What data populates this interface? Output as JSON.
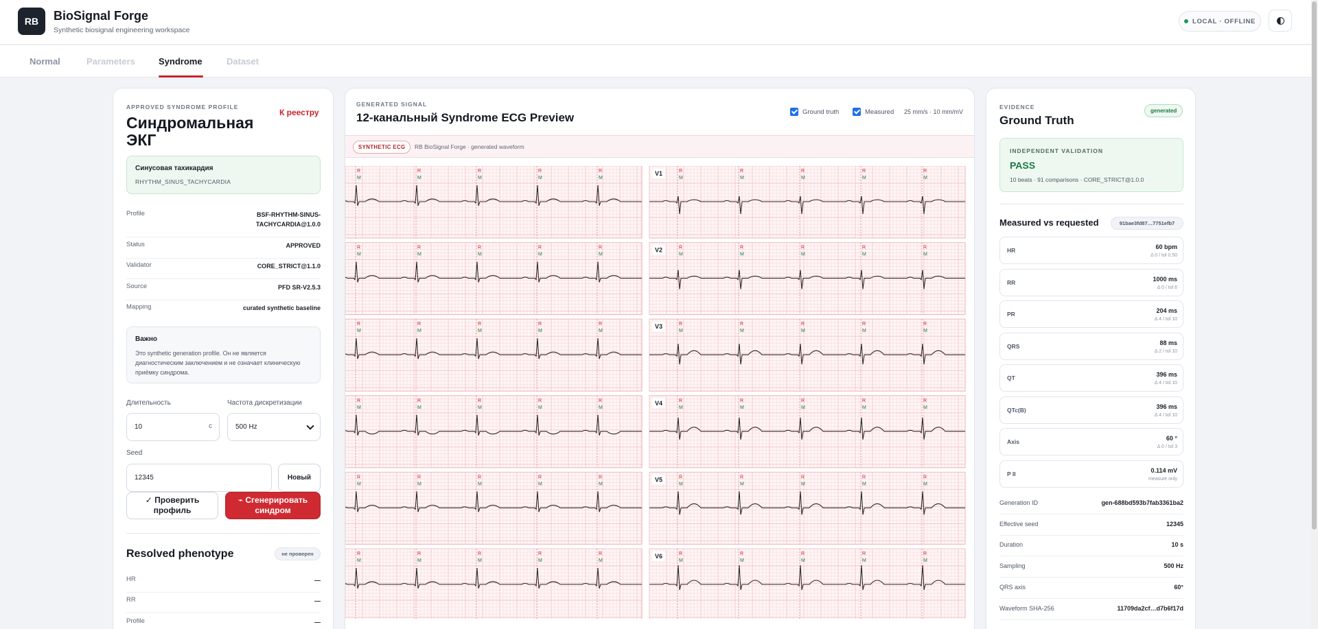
{
  "app": {
    "logo": "RB",
    "title": "BioSignal Forge",
    "subtitle": "Synthetic biosignal engineering workspace",
    "status": "LOCAL · OFFLINE",
    "theme_icon": "contrast-icon"
  },
  "tabs": [
    {
      "label": "Normal",
      "state": "inactive"
    },
    {
      "label": "Parameters",
      "state": "disabled"
    },
    {
      "label": "Syndrome",
      "state": "active"
    },
    {
      "label": "Dataset",
      "state": "disabled"
    }
  ],
  "left": {
    "eyebrow": "APPROVED SYNDROME PROFILE",
    "registry_link": "К реестру",
    "title": "Синдромальная ЭКГ",
    "rhythm_name": "Синусовая тахикардия",
    "rhythm_code": "RHYTHM_SINUS_TACHYCARDIA",
    "details": [
      {
        "k": "Profile",
        "v": "BSF-RHYTHM-SINUS-TACHYCARDIA@1.0.0"
      },
      {
        "k": "Status",
        "v": "APPROVED"
      },
      {
        "k": "Validator",
        "v": "CORE_STRICT@1.1.0"
      },
      {
        "k": "Source",
        "v": "PFD SR-V2.5.3"
      },
      {
        "k": "Mapping",
        "v": "curated synthetic baseline"
      }
    ],
    "note_title": "Важно",
    "note_text": "Это synthetic generation profile. Он не является диагностическим заключением и не означает клиническую приёмку синдрома.",
    "duration_label": "Длительность",
    "duration_value": "10",
    "duration_unit": "c",
    "sampling_label": "Частота дискретизации",
    "sampling_value": "500 Hz",
    "seed_label": "Seed",
    "seed_value": "12345",
    "new_button": "Новый",
    "check_button": "✓ Проверить профиль",
    "generate_button": "⌁ Сгенерировать синдром",
    "phenotype_title": "Resolved phenotype",
    "phenotype_badge": "не проверен",
    "phenotype_rows": [
      {
        "k": "HR",
        "v": "—"
      },
      {
        "k": "RR",
        "v": "—"
      },
      {
        "k": "Profile",
        "v": "—"
      }
    ]
  },
  "center": {
    "eyebrow": "GENERATED SIGNAL",
    "title": "12-канальный Syndrome ECG Preview",
    "ground_truth_label": "Ground truth",
    "ground_truth_checked": true,
    "measured_label": "Measured",
    "measured_checked": true,
    "scale": "25 mm/s · 10 mm/mV",
    "tag": "SYNTHETIC ECG",
    "strip_text": "RB BioSignal Forge · generated waveform",
    "leads_right": [
      "V1",
      "V2",
      "V3",
      "V4",
      "V5",
      "V6"
    ],
    "marker_top": "R",
    "marker_bottom": "M",
    "grid_color": "#f3c4c8",
    "trace_color": "#2b2b2b"
  },
  "right": {
    "eyebrow": "EVIDENCE",
    "badge": "generated",
    "title": "Ground Truth",
    "validation_eyebrow": "INDEPENDENT VALIDATION",
    "validation_result": "PASS",
    "validation_sub": "10 beats · 91 comparisons · CORE_STRICT@1.0.0",
    "mvr_title": "Measured vs requested",
    "hash": "91bae3fd87…7751efb7",
    "metrics": [
      {
        "k": "HR",
        "v": "60 bpm",
        "t": "Δ 0 / tol 0.50"
      },
      {
        "k": "RR",
        "v": "1000 ms",
        "t": "Δ 0 / tol 6"
      },
      {
        "k": "PR",
        "v": "204 ms",
        "t": "Δ 4 / tol 10"
      },
      {
        "k": "QRS",
        "v": "88 ms",
        "t": "Δ 2 / tol 10"
      },
      {
        "k": "QT",
        "v": "396 ms",
        "t": "Δ 4 / tol 10"
      },
      {
        "k": "QTc(B)",
        "v": "396 ms",
        "t": "Δ 4 / tol 10"
      },
      {
        "k": "Axis",
        "v": "60 °",
        "t": "Δ 0 / tol 3"
      },
      {
        "k": "P II",
        "v": "0.114 mV",
        "t": "measure only"
      }
    ],
    "info": [
      {
        "k": "Generation ID",
        "v": "gen-688bd593b7fab3361ba2"
      },
      {
        "k": "Effective seed",
        "v": "12345"
      },
      {
        "k": "Duration",
        "v": "10 s"
      },
      {
        "k": "Sampling",
        "v": "500 Hz"
      },
      {
        "k": "QRS axis",
        "v": "60°"
      },
      {
        "k": "Waveform SHA-256",
        "v": "11709da2cf…d7b6f17d"
      }
    ]
  }
}
